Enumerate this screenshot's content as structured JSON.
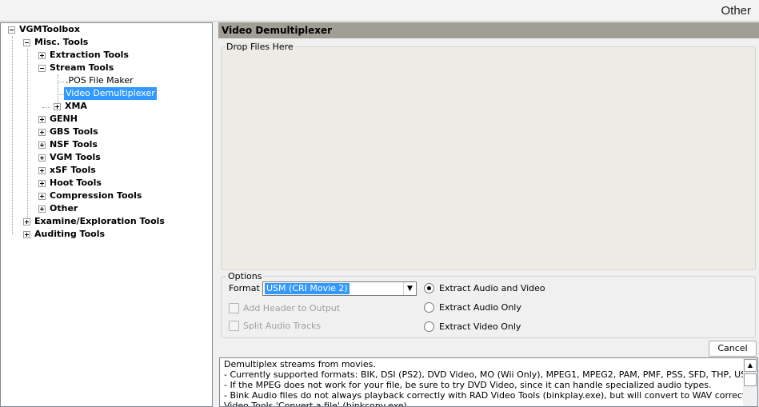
{
  "window": {
    "title": "Other"
  },
  "tree": {
    "root": "VGMToolbox",
    "misc": "Misc. Tools",
    "extraction": "Extraction Tools",
    "stream": "Stream Tools",
    "pos_maker": ".POS File Maker",
    "video_demux": "Video Demultiplexer",
    "xma": "XMA",
    "genh": "GENH",
    "gbs": "GBS Tools",
    "nsf": "NSF Tools",
    "vgm": "VGM Tools",
    "xsf": "xSF Tools",
    "hoot": "Hoot Tools",
    "compression": "Compression Tools",
    "other": "Other",
    "examine": "Examine/Exploration Tools",
    "auditing": "Auditing Tools"
  },
  "panel": {
    "title": "Video Demultiplexer",
    "drop_label": "Drop Files Here",
    "options_label": "Options",
    "format_label": "Format",
    "format_value": "USM (CRI Movie 2)",
    "add_header": "Add Header to Output",
    "split_audio": "Split Audio Tracks",
    "radio_av": "Extract Audio and Video",
    "radio_audio": "Extract Audio Only",
    "radio_video": "Extract Video Only",
    "cancel": "Cancel"
  },
  "description": [
    "Demultiplex streams from movies.",
    "- Currently supported formats: BIK, DSI (PS2), DVD Video, MO (Wii Only), MPEG1, MPEG2, PAM, PMF, PSS, SFD, THP, USM, XMV",
    "- If the MPEG does not work for your file, be sure to try DVD Video, since it can handle specialized audio types.",
    "- Bink Audio files do not always playback correctly with RAD Video Tools (binkplay.exe), but will convert to WAV correctly using RAD",
    "Video Tools 'Convert a file' (binkconv.exe)"
  ]
}
